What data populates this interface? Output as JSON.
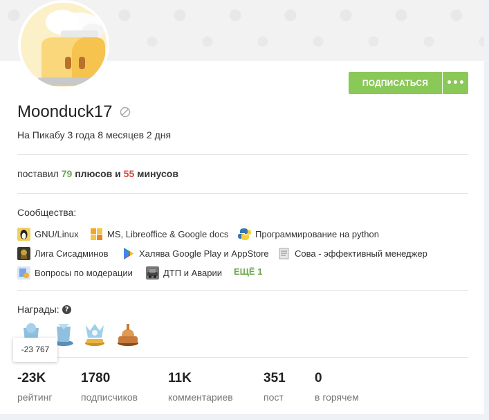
{
  "profile": {
    "username": "Moonduck17",
    "tenure": "На Пикабу 3 года 8 месяцев 2 дня",
    "subscribe_label": "ПОДПИСАТЬСЯ",
    "more_label": "•••"
  },
  "votes": {
    "prefix": "поставил ",
    "plus_count": "79",
    "plus_word": " плюсов",
    "and": " и ",
    "minus_count": "55",
    "minus_word": " минусов"
  },
  "communities": {
    "title": "Сообщества:",
    "items": [
      {
        "label": "GNU/Linux",
        "icon": "penguin-icon"
      },
      {
        "label": "MS, Libreoffice & Google docs",
        "icon": "office-icon"
      },
      {
        "label": "Программирование на python",
        "icon": "python-icon"
      },
      {
        "label": "Лига Сисадминов",
        "icon": "sysadmin-icon"
      },
      {
        "label": "Халява Google Play и AppStore",
        "icon": "play-store-icon"
      },
      {
        "label": "Сова - эффективный менеджер",
        "icon": "owl-icon"
      },
      {
        "label": "Вопросы по модерации",
        "icon": "moderation-icon"
      },
      {
        "label": "ДТП и Аварии",
        "icon": "car-crash-icon"
      }
    ],
    "more_label": "ЕЩЁ 1"
  },
  "awards": {
    "title": "Награды:",
    "help_icon": "question-icon",
    "items": [
      "award-1-icon",
      "award-2-icon",
      "award-3-icon",
      "award-4-icon"
    ]
  },
  "tooltip": "-23 767",
  "stats": [
    {
      "value": "-23K",
      "label": "рейтинг"
    },
    {
      "value": "1780",
      "label": "подписчиков"
    },
    {
      "value": "11K",
      "label": "комментариев"
    },
    {
      "value": "351",
      "label": "пост"
    },
    {
      "value": "0",
      "label": "в горячем"
    }
  ],
  "colors": {
    "accent_green": "#8ac858",
    "plus_green": "#6aa84f",
    "minus_red": "#d5483f"
  }
}
